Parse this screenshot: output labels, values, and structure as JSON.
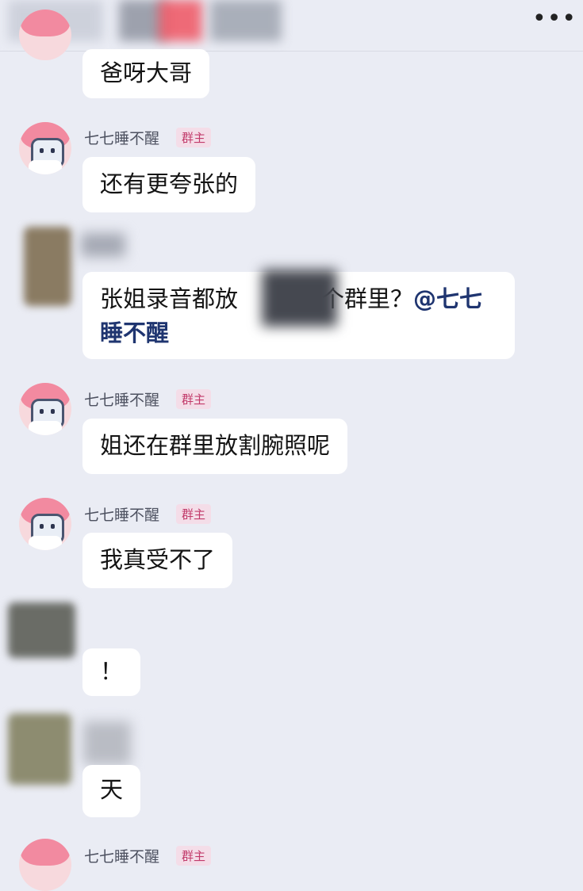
{
  "header": {
    "more_icon": "more-horizontal-icon",
    "more_label": "•••"
  },
  "messages": [
    {
      "text": "爸呀大哥"
    },
    {
      "sender": "七七睡不醒",
      "badge": "群主",
      "text": "还有更夸张的"
    },
    {
      "text_before": "张姐录音都放",
      "text_after": "个群里？",
      "mention": "@七七睡不醒"
    },
    {
      "sender": "七七睡不醒",
      "badge": "群主",
      "text": "姐还在群里放割腕照呢"
    },
    {
      "sender": "七七睡不醒",
      "badge": "群主",
      "text": "我真受不了"
    },
    {
      "text": "！"
    },
    {
      "text": "天"
    },
    {
      "sender": "七七睡不醒",
      "badge": "群主"
    }
  ]
}
